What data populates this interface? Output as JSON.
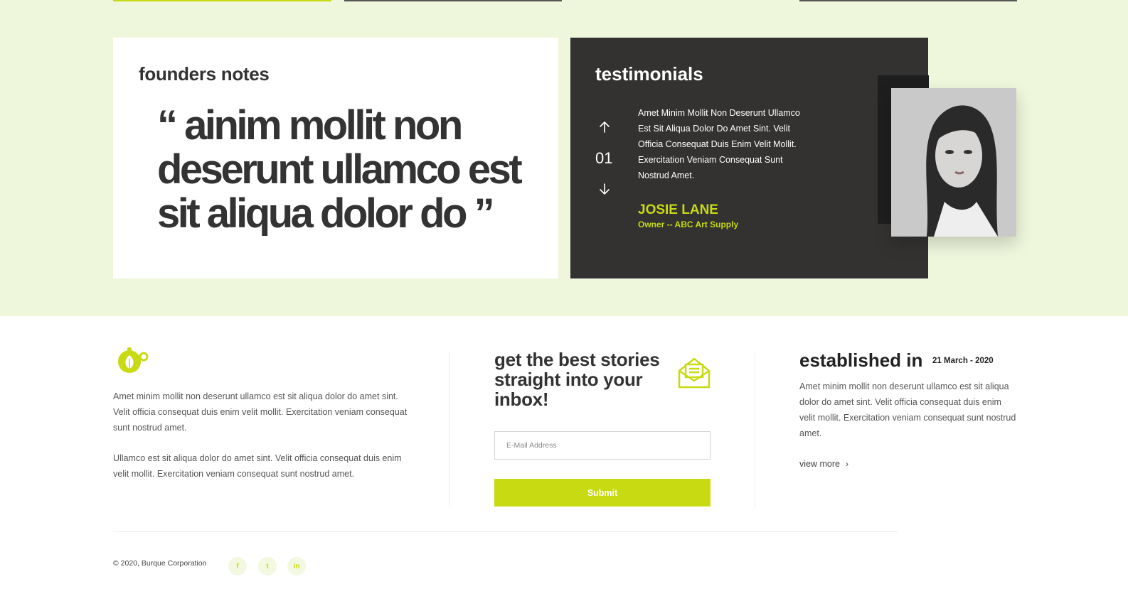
{
  "colors": {
    "accent": "#c8da12",
    "band": "#eef6dc",
    "dark_card": "#333231",
    "text": "#333333"
  },
  "founders": {
    "title": "founders notes",
    "quote": "“ ainim mollit non deserunt ullamco est sit aliqua dolor do ”"
  },
  "testimonials": {
    "title": "testimonials",
    "counter": "01",
    "body": "Amet Minim Mollit Non Deserunt Ullamco Est Sit Aliqua Dolor Do Amet Sint. Velit Officia Consequat Duis Enim Velit Mollit. Exercitation Veniam Consequat Sunt Nostrud Amet.",
    "name": "JOSIE LANE",
    "role": "Owner -- ABC Art Supply",
    "prev_icon": "arrow-up-icon",
    "next_icon": "arrow-down-icon"
  },
  "about": {
    "logo_icon": "teapot-leaf-icon",
    "paragraph_1": "Amet minim mollit non deserunt ullamco est sit aliqua dolor do amet sint. Velit officia consequat duis enim velit mollit. Exercitation veniam consequat sunt nostrud amet.",
    "paragraph_2": "Ullamco est sit aliqua dolor do amet sint. Velit officia consequat duis enim velit mollit. Exercitation veniam consequat sunt nostrud amet."
  },
  "newsletter": {
    "title": "get the best stories straight into your inbox!",
    "icon": "envelope-open-icon",
    "email_placeholder": "E-Mail Address",
    "submit_label": "Submit"
  },
  "established": {
    "title": "established in",
    "date": "21 March - 2020",
    "body": "Amet minim mollit non deserunt ullamco est sit aliqua dolor do amet sint. Velit officia consequat duis enim velit mollit. Exercitation veniam consequat sunt nostrud amet.",
    "link_label": "view more",
    "link_icon": "chevron-right-icon"
  },
  "footer": {
    "copyright": "© 2020, Burque Corporation",
    "social": [
      {
        "name": "facebook",
        "glyph": "f"
      },
      {
        "name": "twitter",
        "glyph": "t"
      },
      {
        "name": "linkedin",
        "glyph": "in"
      }
    ]
  }
}
